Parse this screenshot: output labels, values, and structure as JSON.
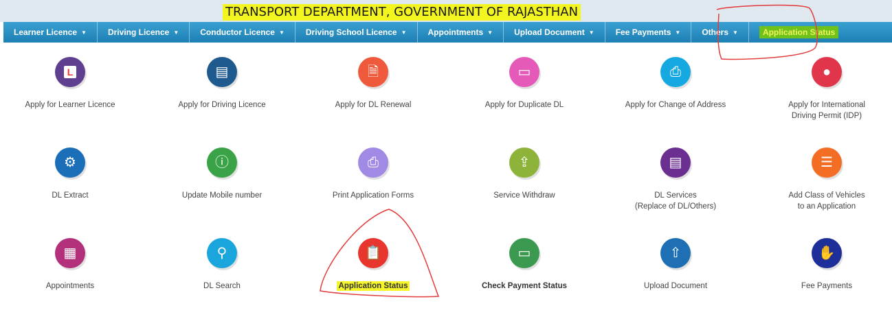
{
  "header": {
    "title": "TRANSPORT DEPARTMENT, GOVERNMENT OF RAJASTHAN"
  },
  "nav": [
    {
      "label": "Learner Licence",
      "dropdown": true
    },
    {
      "label": "Driving Licence",
      "dropdown": true
    },
    {
      "label": "Conductor Licence",
      "dropdown": true
    },
    {
      "label": "Driving School Licence",
      "dropdown": true
    },
    {
      "label": "Appointments",
      "dropdown": true
    },
    {
      "label": "Upload Document",
      "dropdown": true
    },
    {
      "label": "Fee Payments",
      "dropdown": true
    },
    {
      "label": "Others",
      "dropdown": true
    },
    {
      "label": "Application Status",
      "dropdown": false
    }
  ],
  "tiles": [
    {
      "label1": "Apply for Learner Licence",
      "label2": "",
      "icon": "learner-licence-icon",
      "color": "#5f3f8f"
    },
    {
      "label1": "Apply for Driving Licence",
      "label2": "",
      "icon": "driving-licence-icon",
      "color": "#1f5a8e"
    },
    {
      "label1": "Apply for DL Renewal",
      "label2": "",
      "icon": "renewal-document-icon",
      "color": "#ee5a3b"
    },
    {
      "label1": "Apply for Duplicate DL",
      "label2": "",
      "icon": "duplicate-card-icon",
      "color": "#e55ab9"
    },
    {
      "label1": "Apply for Change of Address",
      "label2": "",
      "icon": "printer-icon",
      "color": "#16a8e0"
    },
    {
      "label1": "Apply for International",
      "label2": "Driving Permit (IDP)",
      "icon": "person-icon",
      "color": "#e0354a"
    },
    {
      "label1": "DL Extract",
      "label2": "",
      "icon": "hand-gear-icon",
      "color": "#1b6fb8"
    },
    {
      "label1": "Update Mobile number",
      "label2": "",
      "icon": "mobile-info-icon",
      "color": "#3aa347"
    },
    {
      "label1": "Print Application Forms",
      "label2": "",
      "icon": "print-icon",
      "color": "#a08ae6"
    },
    {
      "label1": "Service Withdraw",
      "label2": "",
      "icon": "upload-tray-icon",
      "color": "#8db33a"
    },
    {
      "label1": "DL Services",
      "label2": "(Replace of DL/Others)",
      "icon": "id-card-icon",
      "color": "#6a2f90"
    },
    {
      "label1": "Add Class of Vehicles",
      "label2": "to an Application",
      "icon": "form-list-icon",
      "color": "#f36e24"
    },
    {
      "label1": "Appointments",
      "label2": "",
      "icon": "calendar-icon",
      "color": "#b3307b"
    },
    {
      "label1": "DL Search",
      "label2": "",
      "icon": "user-search-icon",
      "color": "#1aa6dd"
    },
    {
      "label1": "Application Status",
      "label2": "",
      "icon": "clipboard-status-icon",
      "color": "#e8352e"
    },
    {
      "label1": "Check Payment Status",
      "label2": "",
      "icon": "payment-card-icon",
      "color": "#3b9a4f"
    },
    {
      "label1": "Upload Document",
      "label2": "",
      "icon": "upload-icon",
      "color": "#1e6fb3"
    },
    {
      "label1": "Fee Payments",
      "label2": "",
      "icon": "hand-coin-icon",
      "color": "#1f2f9a"
    }
  ]
}
